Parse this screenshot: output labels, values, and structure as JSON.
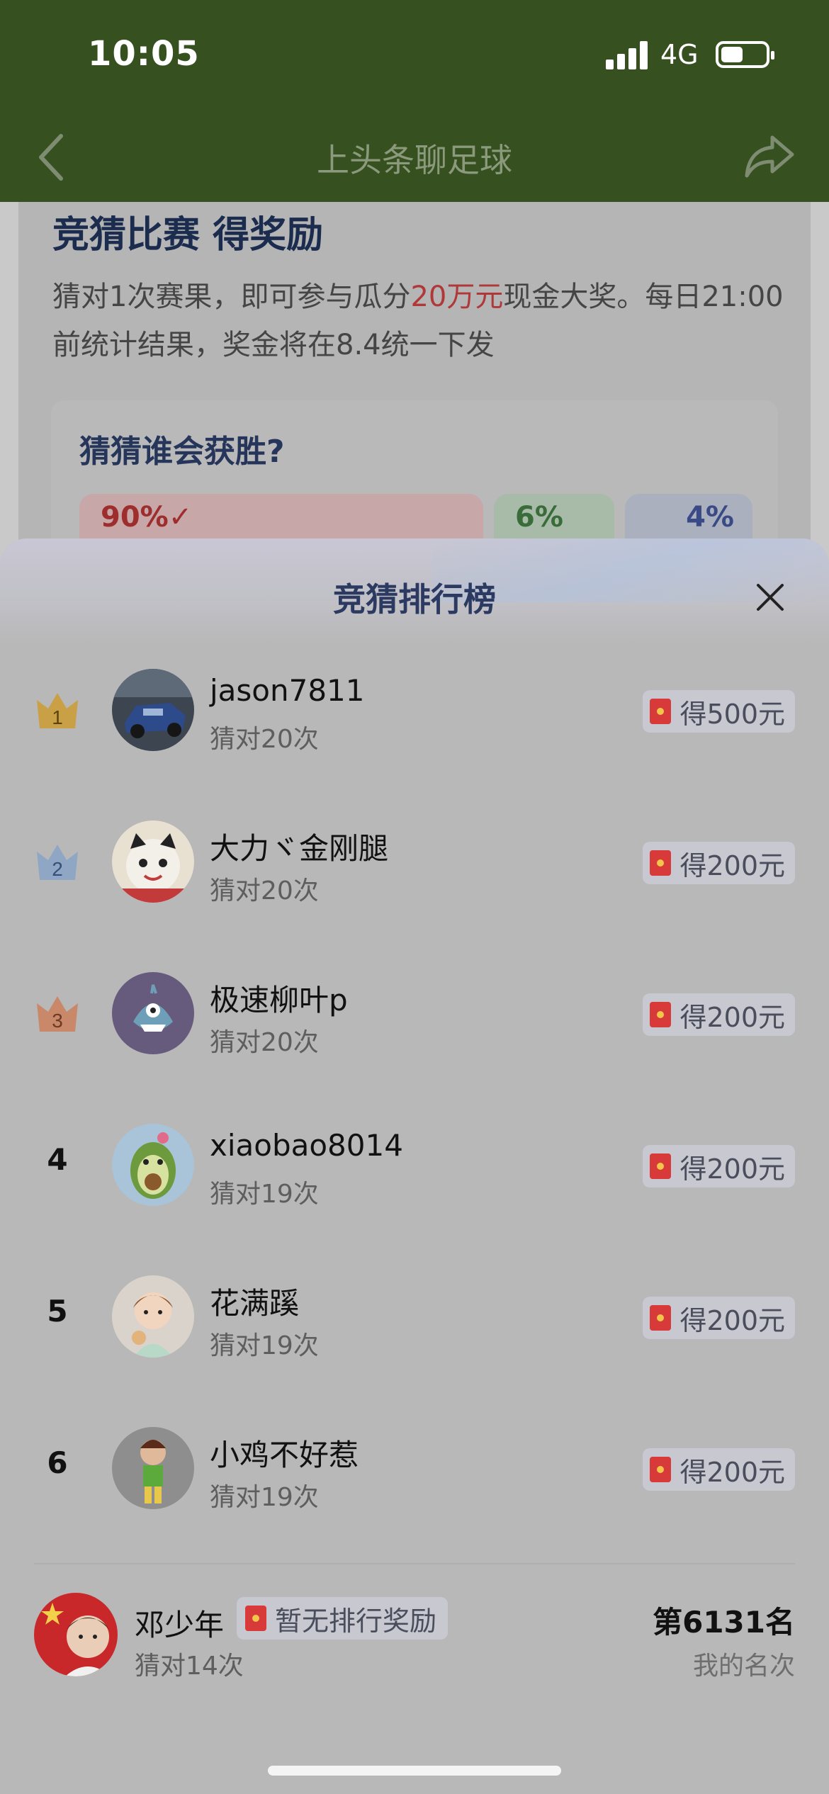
{
  "status_bar": {
    "time": "10:05",
    "network": "4G"
  },
  "navbar": {
    "title": "上头条聊足球"
  },
  "background_card": {
    "title": "竞猜比赛 得奖励",
    "desc_before": "猜对1次赛果，即可参与瓜分",
    "desc_highlight": "20万元",
    "desc_after": "现金大奖。每日21:00前统计结果，奖金将在8.4统一下发",
    "question": "猜猜谁会获胜?",
    "poll": [
      "90%✓",
      "6%",
      "4%"
    ]
  },
  "sheet": {
    "title": "竞猜排行榜",
    "rows": [
      {
        "rank": "1",
        "name": "jason7811",
        "sub": "猜对20次",
        "reward": "得500元"
      },
      {
        "rank": "2",
        "name": "大力ヾ金刚腿",
        "sub": "猜对20次",
        "reward": "得200元"
      },
      {
        "rank": "3",
        "name": "极速柳叶p",
        "sub": "猜对20次",
        "reward": "得200元"
      },
      {
        "rank": "4",
        "name": "xiaobao8014",
        "sub": "猜对19次",
        "reward": "得200元"
      },
      {
        "rank": "5",
        "name": "花满蹊",
        "sub": "猜对19次",
        "reward": "得200元"
      },
      {
        "rank": "6",
        "name": "小鸡不好惹",
        "sub": "猜对19次",
        "reward": "得200元"
      }
    ],
    "me": {
      "name": "邓少年",
      "badge": "暂无排行奖励",
      "sub": "猜对14次",
      "rank": "第6131名",
      "rank_label": "我的名次"
    }
  },
  "colors": {
    "gold": "#c9a045",
    "silver": "#8fa7c4",
    "bronze": "#c9886a",
    "red_packet": "#d83a3a"
  }
}
